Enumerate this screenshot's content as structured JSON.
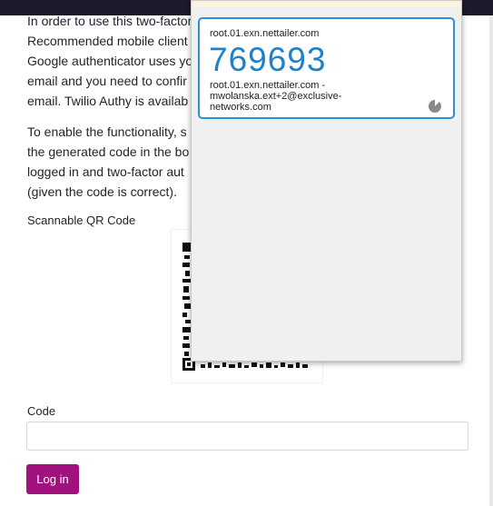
{
  "page": {
    "intro_lines": [
      "In order to use this two-factor",
      "Recommended mobile client",
      "Google authenticator uses yo",
      "email and you need to confir",
      "email. Twilio Authy is availab"
    ],
    "enable_lines": [
      "To enable the functionality, s",
      "the generated code in the bo",
      "logged in and two-factor aut",
      "(given the code is correct)."
    ],
    "qr_label": "Scannable QR Code",
    "code_label": "Code",
    "code_value": "",
    "login_label": "Log in"
  },
  "popup": {
    "account": {
      "issuer": "root.01.exn.nettailer.com",
      "code": "769693",
      "name_lines": [
        "root.01.exn.nettailer.com -",
        "mwolanska.ext+2@exclusive-",
        "networks.com"
      ],
      "timer_icon": "pie-timer-icon"
    }
  },
  "colors": {
    "accent_button": "#a0137f",
    "code_blue": "#1f82c8",
    "card_border": "#2e8fd3",
    "popup_bg": "#f0f0f0"
  }
}
